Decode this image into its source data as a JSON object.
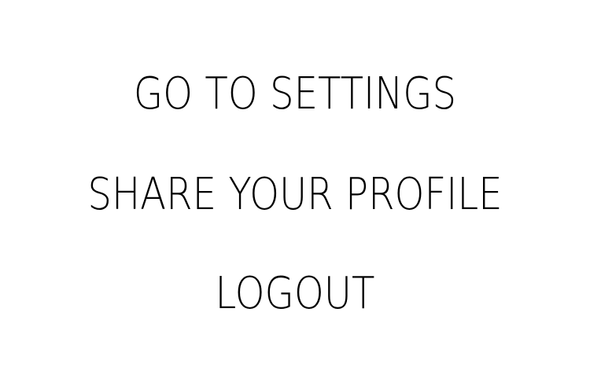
{
  "menu": {
    "items": [
      {
        "label": "GO TO SETTINGS"
      },
      {
        "label": "SHARE YOUR PROFILE"
      },
      {
        "label": "LOGOUT"
      }
    ]
  },
  "colors": {
    "background": "#ffffff",
    "text": "#000000"
  }
}
